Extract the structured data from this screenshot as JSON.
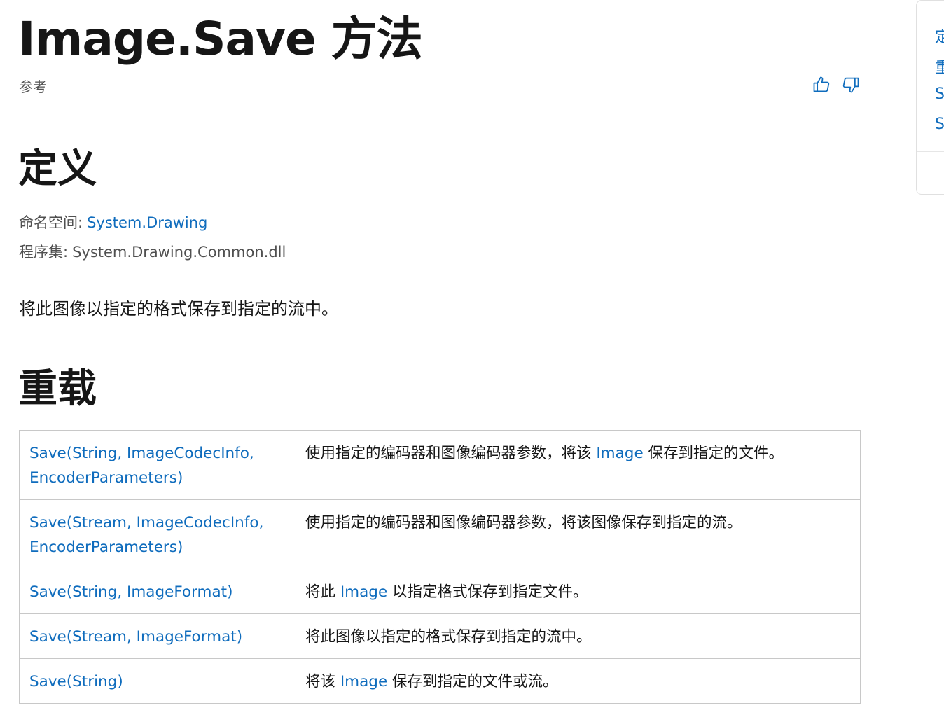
{
  "header": {
    "title": "Image.Save 方法",
    "reference_label": "参考"
  },
  "feedback": {
    "like_icon": "thumbs-up-icon",
    "dislike_icon": "thumbs-down-icon"
  },
  "definition": {
    "heading": "定义",
    "namespace_label": "命名空间:",
    "namespace_value": "System.Drawing",
    "assembly_label": "程序集:",
    "assembly_value": "System.Drawing.Common.dll",
    "summary": "将此图像以指定的格式保存到指定的流中。"
  },
  "overloads": {
    "heading": "重载",
    "rows": [
      {
        "signature_line1": "Save(String, ImageCodecInfo,",
        "signature_line2": "EncoderParameters)",
        "desc_before": "使用指定的编码器和图像编码器参数，将该 ",
        "desc_link": "Image",
        "desc_after": " 保存到指定的文件。"
      },
      {
        "signature_line1": "Save(Stream, ImageCodecInfo,",
        "signature_line2": "EncoderParameters)",
        "desc_before": "使用指定的编码器和图像编码器参数，将该图像保存到指定的流。",
        "desc_link": "",
        "desc_after": ""
      },
      {
        "signature_line1": "Save(String, ImageFormat)",
        "signature_line2": "",
        "desc_before": "将此 ",
        "desc_link": "Image",
        "desc_after": " 以指定格式保存到指定文件。"
      },
      {
        "signature_line1": "Save(Stream, ImageFormat)",
        "signature_line2": "",
        "desc_before": "将此图像以指定的格式保存到指定的流中。",
        "desc_link": "",
        "desc_after": ""
      },
      {
        "signature_line1": "Save(String)",
        "signature_line2": "",
        "desc_before": "将该 ",
        "desc_link": "Image",
        "desc_after": " 保存到指定的文件或流。"
      }
    ]
  },
  "toc": {
    "items": [
      "定",
      "重",
      "S",
      "S"
    ]
  },
  "colors": {
    "link": "#0f6cbd",
    "text": "#161616",
    "muted": "#505050",
    "border": "#c8c8c8"
  }
}
